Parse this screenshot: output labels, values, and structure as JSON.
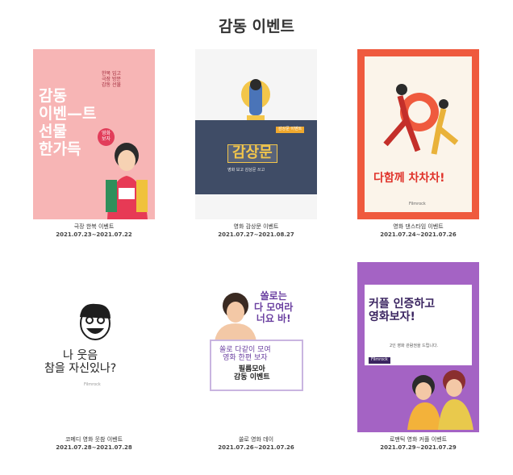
{
  "page": {
    "title": "감동 이벤트"
  },
  "events": [
    {
      "caption": "극장 한복 이벤트",
      "period": "2021.07.23~2021.07.22",
      "poster": {
        "bg": "#f7b5b5",
        "headline": "감동\n이벤—트\n선물\n한가득",
        "sub": "한복 입고\n극장 방문\n감동 선물",
        "badge": "영화\n보자"
      }
    },
    {
      "caption": "영화 감상문 이벤트",
      "period": "2021.07.27~2021.08.27",
      "poster": {
        "bg": "#3f4c66",
        "headline": "감상문",
        "sub": "영화 보고 감상문 쓰고",
        "badge": "감상문 이벤트"
      }
    },
    {
      "caption": "영화 댄스타임 이벤트",
      "period": "2021.07.24~2021.07.26",
      "poster": {
        "bg": "#ef5a3e",
        "headline": "다함께 차차차!",
        "sub": "Filmrock"
      }
    },
    {
      "caption": "코메디 영화 웃참 이벤트",
      "period": "2021.07.28~2021.07.28",
      "poster": {
        "bg": "#ffffff",
        "headline": "나 웃음\n참을 자신있나?",
        "sub": "Filmrock"
      }
    },
    {
      "caption": "쏠로 영화 데이",
      "period": "2021.07.26~2021.07.26",
      "poster": {
        "bg": "#ffffff",
        "headline": "쏠로는\n다 모여라\n너요 바!",
        "sub": "쏠로 다같이 모여\n영화 한편 보자",
        "badge": "필름모아\n감동 이벤트"
      }
    },
    {
      "caption": "로맨틱 영화 커플 이벤트",
      "period": "2021.07.29~2021.07.29",
      "poster": {
        "bg": "#a463c4",
        "headline": "커플 인증하고\n영화보자!",
        "sub": "2인 영화 관람권을 드립니다.",
        "badge": "Filmrock"
      }
    }
  ],
  "colors": {
    "title": "#333333",
    "pink": "#f7b5b5",
    "navy": "#3f4c66",
    "orange": "#ef5a3e",
    "purple": "#a463c4"
  }
}
